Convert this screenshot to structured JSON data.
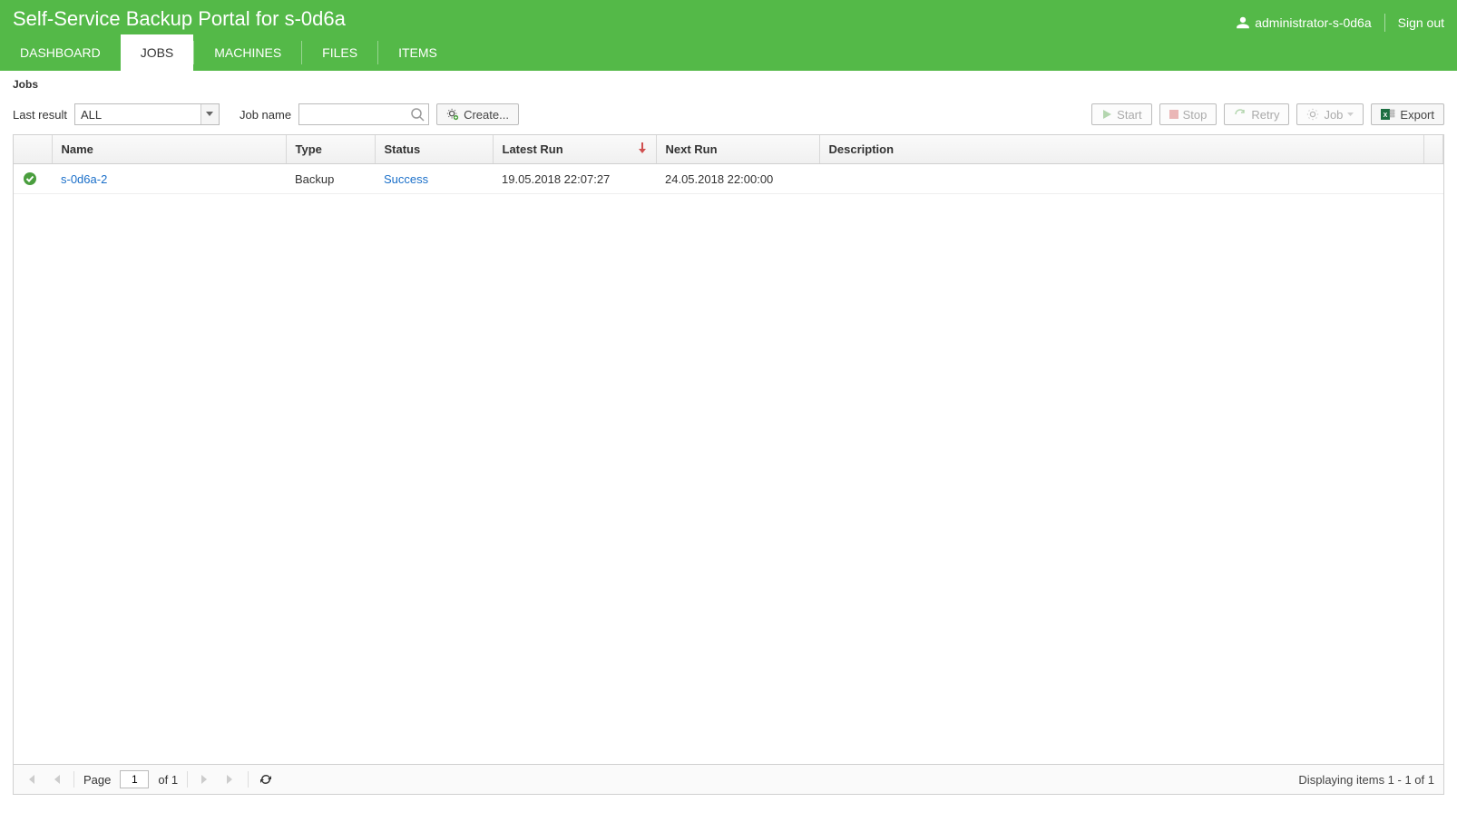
{
  "header": {
    "title": "Self-Service Backup Portal for s-0d6a",
    "user": "administrator-s-0d6a",
    "sign_out": "Sign out"
  },
  "tabs": {
    "dashboard": "DASHBOARD",
    "jobs": "JOBS",
    "machines": "MACHINES",
    "files": "FILES",
    "items": "ITEMS"
  },
  "breadcrumb": "Jobs",
  "toolbar": {
    "last_result_label": "Last result",
    "last_result_value": "ALL",
    "job_name_label": "Job name",
    "create": "Create...",
    "start": "Start",
    "stop": "Stop",
    "retry": "Retry",
    "job": "Job",
    "export": "Export"
  },
  "grid": {
    "columns": {
      "name": "Name",
      "type": "Type",
      "status": "Status",
      "latest_run": "Latest Run",
      "next_run": "Next Run",
      "description": "Description"
    },
    "rows": [
      {
        "name": "s-0d6a-2",
        "type": "Backup",
        "status": "Success",
        "latest_run": "19.05.2018 22:07:27",
        "next_run": "24.05.2018 22:00:00",
        "description": ""
      }
    ]
  },
  "pager": {
    "page_label": "Page",
    "current": "1",
    "of_label": "of 1",
    "info": "Displaying items 1 - 1 of 1"
  }
}
